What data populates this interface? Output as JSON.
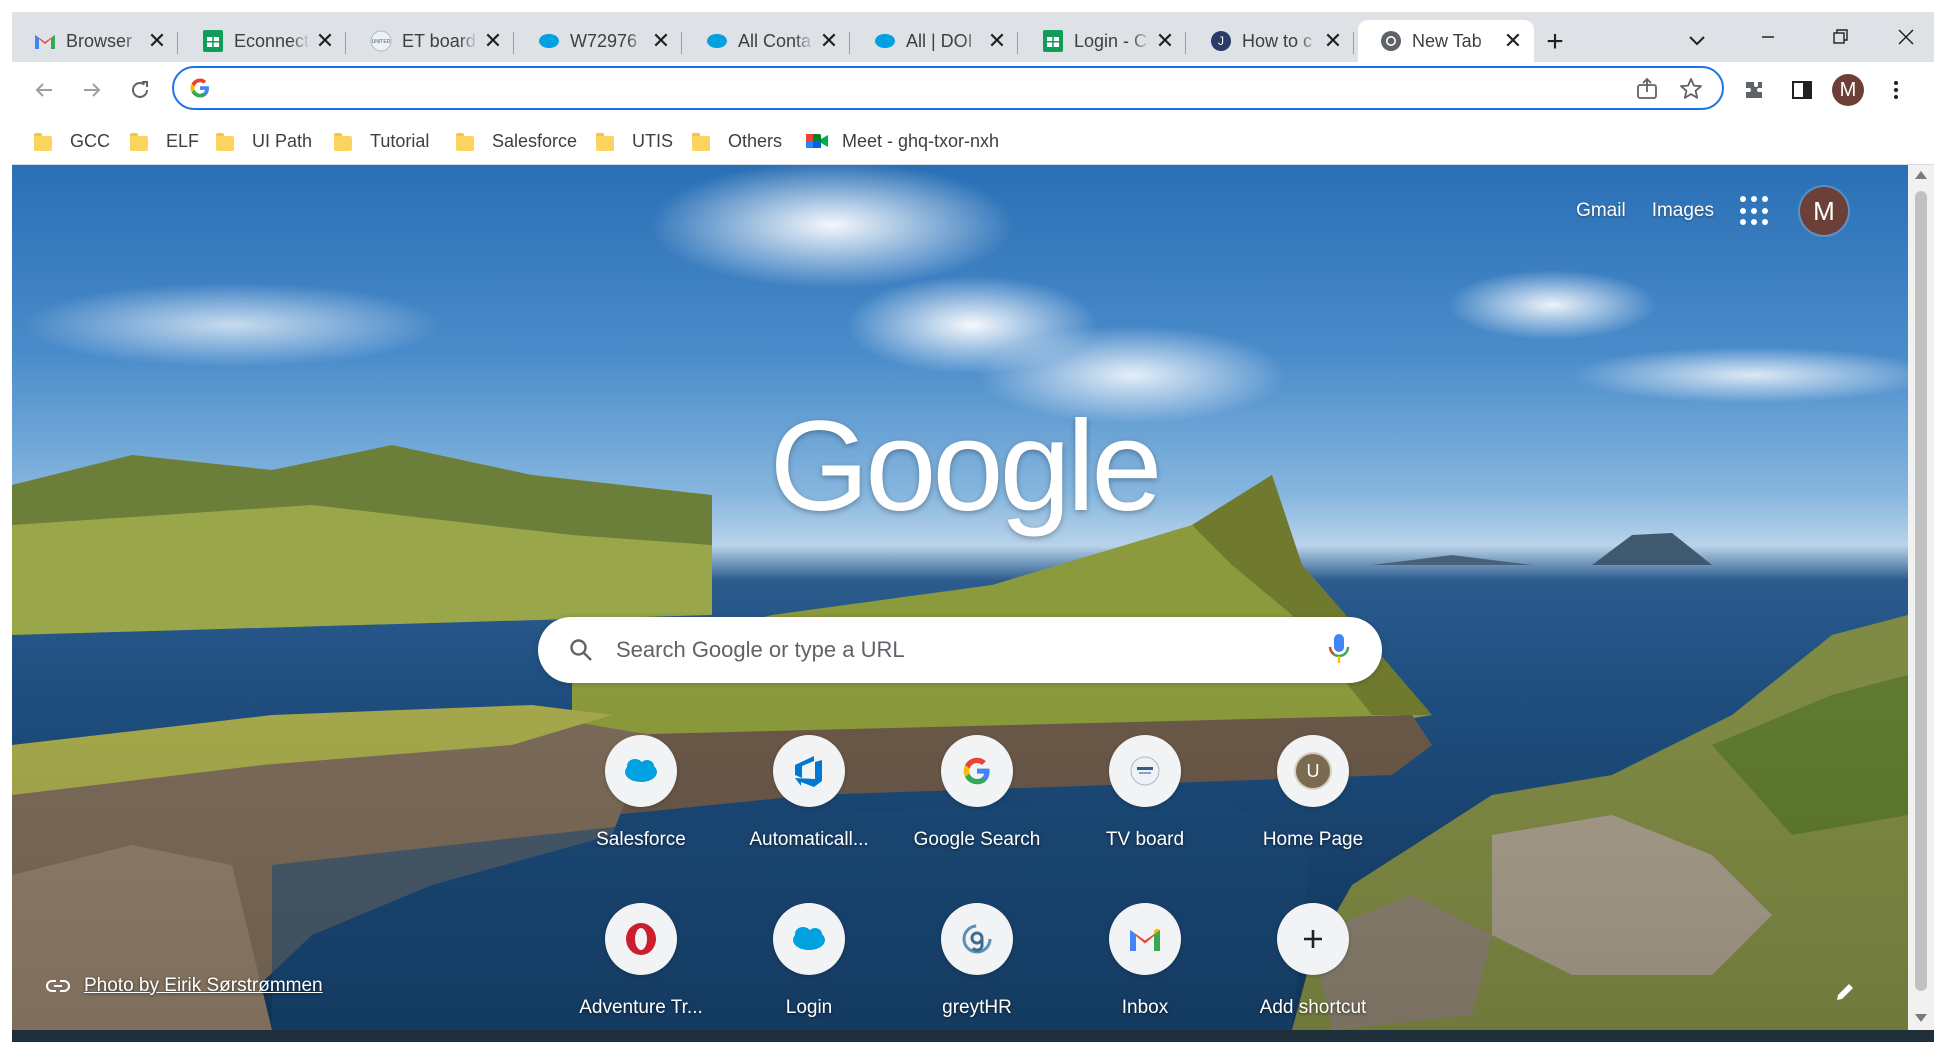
{
  "tabs": [
    {
      "title": "Browser",
      "icon": "gmail-icon"
    },
    {
      "title": "Econnect",
      "icon": "sheets-icon"
    },
    {
      "title": "ET board",
      "icon": "site-icon"
    },
    {
      "title": "W72976",
      "icon": "salesforce-icon"
    },
    {
      "title": "All Conta",
      "icon": "salesforce-icon"
    },
    {
      "title": "All | DOI",
      "icon": "salesforce-icon"
    },
    {
      "title": "Login - C",
      "icon": "sheets-icon"
    },
    {
      "title": "How to c",
      "icon": "j-icon"
    },
    {
      "title": "New Tab",
      "icon": "chrome-icon",
      "active": true
    }
  ],
  "omnibox": {
    "value": "",
    "placeholder": ""
  },
  "bookmarks": [
    {
      "label": "GCC",
      "type": "folder"
    },
    {
      "label": "ELF",
      "type": "folder"
    },
    {
      "label": "UI Path",
      "type": "folder"
    },
    {
      "label": "Tutorial",
      "type": "folder"
    },
    {
      "label": "Salesforce",
      "type": "folder"
    },
    {
      "label": "UTIS",
      "type": "folder"
    },
    {
      "label": "Others",
      "type": "folder"
    },
    {
      "label": "Meet - ghq-txor-nxh",
      "type": "meet"
    }
  ],
  "profile_initial": "M",
  "ntp": {
    "gmail_link": "Gmail",
    "images_link": "Images",
    "logo_text": "Google",
    "search_placeholder": "Search Google or type a URL",
    "shortcuts": [
      {
        "label": "Salesforce",
        "icon": "salesforce-icon"
      },
      {
        "label": "Automaticall...",
        "icon": "azure-devops-icon"
      },
      {
        "label": "Google Search",
        "icon": "google-g-icon"
      },
      {
        "label": "TV board",
        "icon": "site-icon"
      },
      {
        "label": "Home Page",
        "icon": "u-avatar-icon"
      },
      {
        "label": "Adventure Tr...",
        "icon": "opera-icon"
      },
      {
        "label": "Login",
        "icon": "salesforce-icon"
      },
      {
        "label": "greytHR",
        "icon": "greythr-icon"
      },
      {
        "label": "Inbox",
        "icon": "gmail-icon"
      },
      {
        "label": "Add shortcut",
        "icon": "plus-icon"
      }
    ],
    "photo_credit": "Photo by Eirik Sørstrømmen",
    "home_page_initial": "U"
  },
  "colors": {
    "accent": "#1a73e8",
    "tabstrip": "#dee1e6",
    "avatar": "#6d4037"
  }
}
